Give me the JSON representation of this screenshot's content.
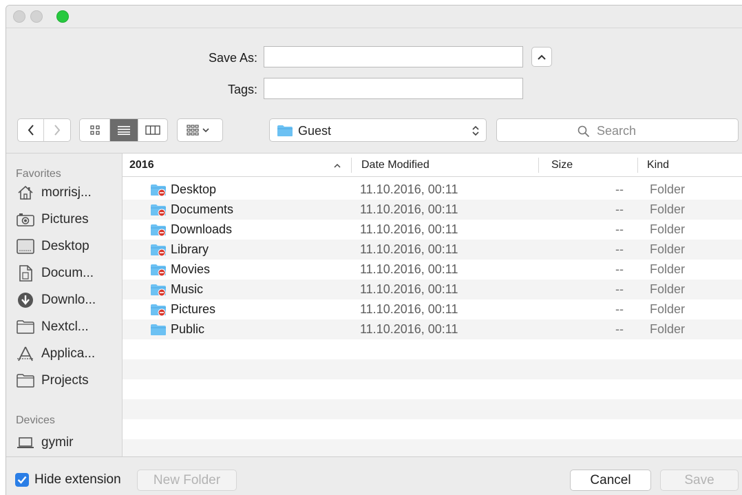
{
  "form": {
    "save_as_label": "Save As:",
    "save_as_value": "",
    "tags_label": "Tags:",
    "tags_value": ""
  },
  "toolbar": {
    "back_icon": "chevron-left-icon",
    "forward_icon": "chevron-right-icon",
    "view_modes": [
      "icon-view",
      "list-view",
      "column-view"
    ],
    "active_view": "list-view",
    "location": "Guest",
    "search_placeholder": "Search"
  },
  "sidebar": {
    "favorites_heading": "Favorites",
    "favorites": [
      {
        "label": "morrisj...",
        "icon": "home-icon"
      },
      {
        "label": "Pictures",
        "icon": "camera-icon"
      },
      {
        "label": "Desktop",
        "icon": "desktop-icon"
      },
      {
        "label": "Docum...",
        "icon": "document-icon"
      },
      {
        "label": "Downlo...",
        "icon": "download-icon"
      },
      {
        "label": "Nextcl...",
        "icon": "folder-icon"
      },
      {
        "label": "Applica...",
        "icon": "applications-icon"
      },
      {
        "label": "Projects",
        "icon": "folder-icon"
      }
    ],
    "devices_heading": "Devices",
    "devices": [
      {
        "label": "gymir",
        "icon": "laptop-icon"
      }
    ]
  },
  "list": {
    "columns": {
      "name": "2016",
      "date": "Date Modified",
      "size": "Size",
      "kind": "Kind"
    },
    "sort_indicator": "^",
    "rows": [
      {
        "name": "Desktop",
        "date": "11.10.2016, 00:11",
        "size": "--",
        "kind": "Folder",
        "restricted": true
      },
      {
        "name": "Documents",
        "date": "11.10.2016, 00:11",
        "size": "--",
        "kind": "Folder",
        "restricted": true
      },
      {
        "name": "Downloads",
        "date": "11.10.2016, 00:11",
        "size": "--",
        "kind": "Folder",
        "restricted": true
      },
      {
        "name": "Library",
        "date": "11.10.2016, 00:11",
        "size": "--",
        "kind": "Folder",
        "restricted": true
      },
      {
        "name": "Movies",
        "date": "11.10.2016, 00:11",
        "size": "--",
        "kind": "Folder",
        "restricted": true
      },
      {
        "name": "Music",
        "date": "11.10.2016, 00:11",
        "size": "--",
        "kind": "Folder",
        "restricted": true
      },
      {
        "name": "Pictures",
        "date": "11.10.2016, 00:11",
        "size": "--",
        "kind": "Folder",
        "restricted": true
      },
      {
        "name": "Public",
        "date": "11.10.2016, 00:11",
        "size": "--",
        "kind": "Folder",
        "restricted": false
      }
    ]
  },
  "bottom": {
    "hide_extension_label": "Hide extension",
    "hide_extension_checked": true,
    "new_folder_label": "New Folder",
    "cancel_label": "Cancel",
    "save_label": "Save"
  },
  "colors": {
    "folder": "#6cc1f3",
    "restricted_badge": "#d9362b",
    "checkbox": "#2a7ee6",
    "zoom_button": "#27c93f"
  }
}
